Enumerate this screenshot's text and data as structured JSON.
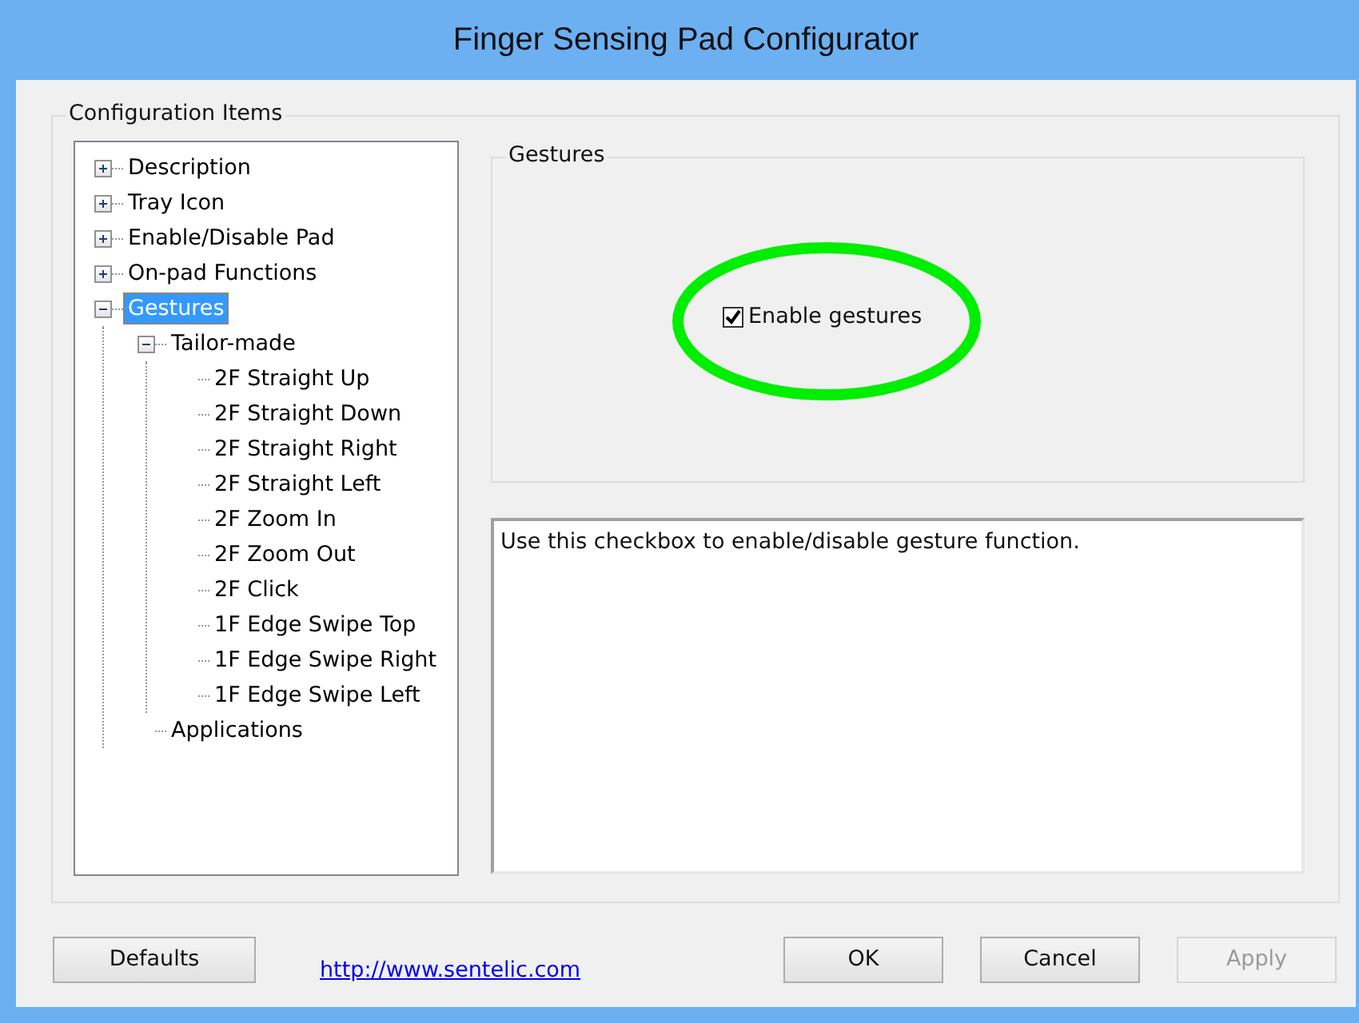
{
  "window": {
    "title": "Finger Sensing Pad Configurator"
  },
  "config_group": {
    "title": "Configuration Items"
  },
  "tree": [
    {
      "label": "Description",
      "expanded": false,
      "selected": false
    },
    {
      "label": "Tray Icon",
      "expanded": false,
      "selected": false
    },
    {
      "label": "Enable/Disable Pad",
      "expanded": false,
      "selected": false
    },
    {
      "label": "On-pad Functions",
      "expanded": false,
      "selected": false
    },
    {
      "label": "Gestures",
      "expanded": true,
      "selected": true,
      "children": [
        {
          "label": "Tailor-made",
          "expanded": true,
          "selected": false,
          "children": [
            {
              "label": "2F Straight Up",
              "selected": false
            },
            {
              "label": "2F Straight Down",
              "selected": false
            },
            {
              "label": "2F Straight Right",
              "selected": false
            },
            {
              "label": "2F Straight Left",
              "selected": false
            },
            {
              "label": "2F Zoom In",
              "selected": false
            },
            {
              "label": "2F Zoom Out",
              "selected": false
            },
            {
              "label": "2F Click",
              "selected": false
            },
            {
              "label": "1F Edge Swipe Top",
              "selected": false
            },
            {
              "label": "1F Edge Swipe Right",
              "selected": false
            },
            {
              "label": "1F Edge Swipe Left",
              "selected": false
            }
          ]
        },
        {
          "label": "Applications",
          "selected": false
        }
      ]
    }
  ],
  "gestures_group": {
    "title": "Gestures",
    "checkbox": {
      "label": "Enable gestures",
      "checked": true
    }
  },
  "description": "Use this checkbox to enable/disable gesture function.",
  "footer": {
    "defaults": "Defaults",
    "link": "http://www.sentelic.com",
    "buttons": [
      {
        "label": "OK",
        "disabled": false
      },
      {
        "label": "Cancel",
        "disabled": false
      },
      {
        "label": "Apply",
        "disabled": true
      }
    ]
  }
}
